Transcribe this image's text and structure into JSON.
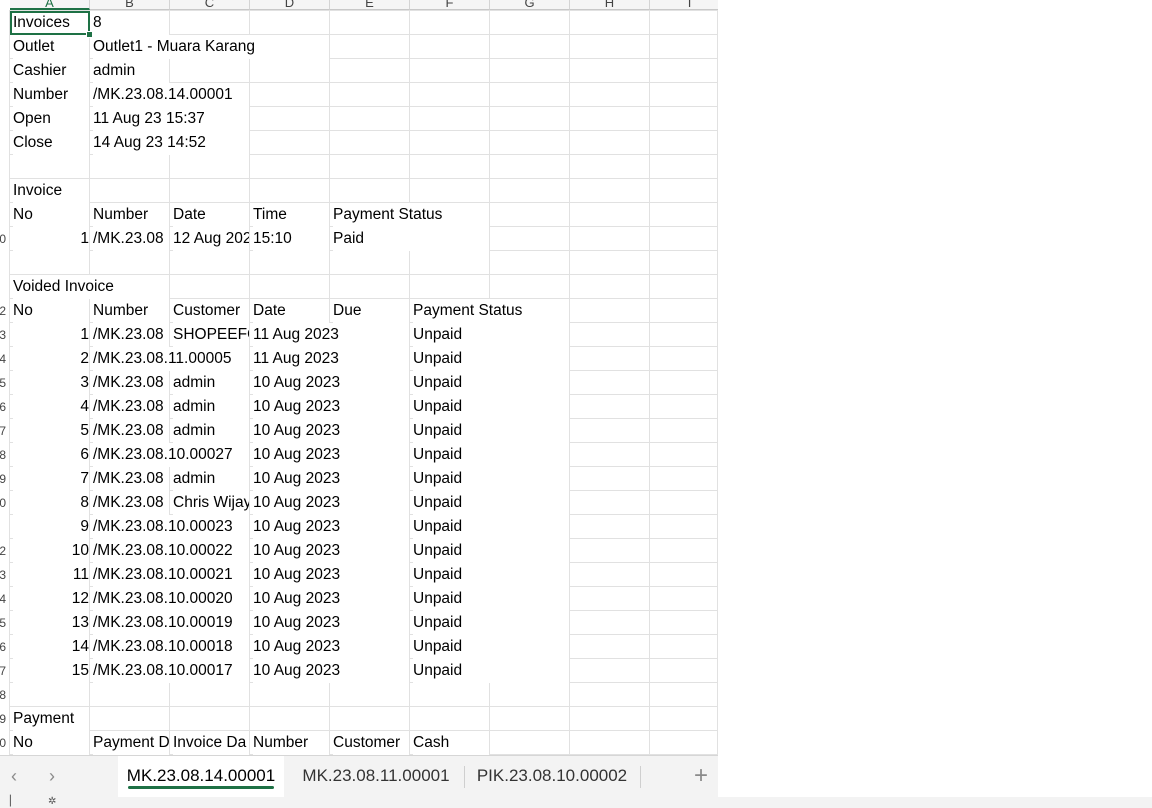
{
  "sheet": {
    "columns": [
      "A",
      "B",
      "C",
      "D",
      "E",
      "F",
      "G",
      "H",
      "I"
    ],
    "rows_visible": [
      "",
      "",
      "",
      "",
      "",
      "",
      "",
      "",
      "",
      "0",
      "",
      "",
      "2",
      "3",
      "4",
      "5",
      "6",
      "7",
      "8",
      "9",
      "0",
      "",
      "2",
      "3",
      "4",
      "5",
      "6",
      "7",
      "8",
      "9",
      "0",
      ""
    ],
    "summary": {
      "invoices_label": "Invoices",
      "invoices_value": "8",
      "outlet_label": "Outlet",
      "outlet_value": "Outlet1 - Muara Karang",
      "cashier_label": "Cashier",
      "cashier_value": "admin",
      "number_label": "Number",
      "number_value": "/MK.23.08.14.00001",
      "open_label": "Open",
      "open_value": "11 Aug 23 15:37",
      "close_label": "Close",
      "close_value": "14 Aug 23 14:52"
    },
    "invoice_section": {
      "title": "Invoice",
      "headers": [
        "No",
        "Number",
        "Date",
        "Time",
        "Payment Status"
      ],
      "rows": [
        [
          "1",
          "/MK.23.08",
          "12 Aug 202",
          "15:10",
          "Paid"
        ]
      ]
    },
    "voided_section": {
      "title": "Voided Invoice",
      "headers": [
        "No",
        "Number",
        "Customer",
        "Date",
        "Due",
        "Payment Status"
      ],
      "rows": [
        [
          "1",
          "/MK.23.08",
          "SHOPEEFO",
          "11 Aug 2023",
          "",
          "Unpaid"
        ],
        [
          "2",
          "/MK.23.08.11.00005",
          "",
          "11 Aug 2023",
          "",
          "Unpaid"
        ],
        [
          "3",
          "/MK.23.08",
          "admin",
          "10 Aug 2023",
          "",
          "Unpaid"
        ],
        [
          "4",
          "/MK.23.08",
          "admin",
          "10 Aug 2023",
          "",
          "Unpaid"
        ],
        [
          "5",
          "/MK.23.08",
          "admin",
          "10 Aug 2023",
          "",
          "Unpaid"
        ],
        [
          "6",
          "/MK.23.08.10.00027",
          "",
          "10 Aug 2023",
          "",
          "Unpaid"
        ],
        [
          "7",
          "/MK.23.08",
          "admin",
          "10 Aug 2023",
          "",
          "Unpaid"
        ],
        [
          "8",
          "/MK.23.08",
          "Chris Wijay",
          "10 Aug 2023",
          "",
          "Unpaid"
        ],
        [
          "9",
          "/MK.23.08.10.00023",
          "",
          "10 Aug 2023",
          "",
          "Unpaid"
        ],
        [
          "10",
          "/MK.23.08.10.00022",
          "",
          "10 Aug 2023",
          "",
          "Unpaid"
        ],
        [
          "11",
          "/MK.23.08.10.00021",
          "",
          "10 Aug 2023",
          "",
          "Unpaid"
        ],
        [
          "12",
          "/MK.23.08.10.00020",
          "",
          "10 Aug 2023",
          "",
          "Unpaid"
        ],
        [
          "13",
          "/MK.23.08.10.00019",
          "",
          "10 Aug 2023",
          "",
          "Unpaid"
        ],
        [
          "14",
          "/MK.23.08.10.00018",
          "",
          "10 Aug 2023",
          "",
          "Unpaid"
        ],
        [
          "15",
          "/MK.23.08.10.00017",
          "",
          "10 Aug 2023",
          "",
          "Unpaid"
        ]
      ]
    },
    "payment_section": {
      "title": "Payment",
      "headers": [
        "No",
        "Payment D",
        "Invoice Da",
        "Number",
        "Customer",
        "Cash"
      ]
    }
  },
  "tabs": {
    "items": [
      "MK.23.08.14.00001",
      "MK.23.08.11.00001",
      "PIK.23.08.10.00002"
    ],
    "active_index": 0,
    "prev_icon": "‹",
    "next_icon": "›",
    "add_icon": "+"
  },
  "colors": {
    "accent": "#1e7145",
    "grid": "#e1e1e1"
  }
}
